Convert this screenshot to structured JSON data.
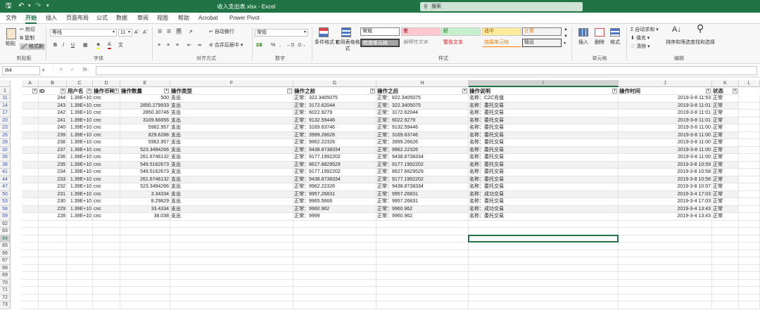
{
  "window": {
    "title": "收入支出表.xlsx  -  Excel",
    "search_placeholder": "搜索",
    "quick_access": [
      "save-icon",
      "undo-icon",
      "redo-icon",
      "customize-icon"
    ]
  },
  "tabs": [
    "文件",
    "开始",
    "插入",
    "页面布局",
    "公式",
    "数据",
    "审阅",
    "视图",
    "帮助",
    "Acrobat",
    "Power Pivot"
  ],
  "active_tab": "开始",
  "ribbon": {
    "clipboard": {
      "paste": "粘贴",
      "cut": "剪切",
      "copy": "复制",
      "format_painter": "格式刷",
      "label": "剪贴板"
    },
    "font": {
      "name": "等线",
      "size": "11",
      "label": "字体"
    },
    "alignment": {
      "wrap": "自动换行",
      "merge": "合并后居中",
      "label": "对齐方式"
    },
    "number": {
      "format": "常规",
      "label": "数字"
    },
    "styles": {
      "conditional": "条件格式",
      "table_format": "套用表格格式",
      "items": [
        "常规",
        "差",
        "好",
        "适中",
        "计算",
        "检查单元格",
        "解释性文本",
        "警告文本",
        "链接单元格",
        "输出"
      ],
      "label": "样式"
    },
    "cells": {
      "insert": "插入",
      "delete": "删除",
      "format": "格式",
      "label": "单元格"
    },
    "editing": {
      "autosum": "自动求和",
      "fill": "填充",
      "clear": "清除",
      "sort": "排序和筛选",
      "find": "查找和选择",
      "label": "编辑"
    }
  },
  "formula_bar": {
    "name_box": "I64",
    "fx": "fx",
    "content": ""
  },
  "columns": [
    "A",
    "B",
    "C",
    "D",
    "E",
    "F",
    "G",
    "H",
    "I",
    "J",
    "K",
    "L"
  ],
  "active_column": "I",
  "headers": [
    "",
    "ID",
    "用户名",
    "操作币种",
    "操作数量",
    "操作类型",
    "操作之前",
    "操作之后",
    "操作说明",
    "操作时间",
    "状态"
  ],
  "rows": [
    {
      "row": "11",
      "id": "244",
      "user": "1.39E+10",
      "coin": "cnc",
      "qty": "500",
      "type": "支出",
      "before": "正常：322.3405075",
      "after": "正常：822.3405075",
      "desc": "名称：C2C充值",
      "time": "2019-3-8 11:53",
      "status": "正常"
    },
    {
      "row": "14",
      "id": "243",
      "user": "1.39E+10",
      "coin": "cnc",
      "qty": "2850.279933",
      "type": "支出",
      "before": "正常：3172.62044",
      "after": "正常：322.3405075",
      "desc": "名称：委托交易",
      "time": "2019-3-8 11:01",
      "status": "正常"
    },
    {
      "row": "17",
      "id": "242",
      "user": "1.39E+10",
      "coin": "cnc",
      "qty": "2850.30746",
      "type": "支出",
      "before": "正常：6022.9279",
      "after": "正常：3172.62044",
      "desc": "名称：委托交易",
      "time": "2019-3-8 11:01",
      "status": "正常"
    },
    {
      "row": "20",
      "id": "241",
      "user": "1.39E+10",
      "coin": "cnc",
      "qty": "3109.66656",
      "type": "支出",
      "before": "正常：9132.59446",
      "after": "正常：6022.9279",
      "desc": "名称：委托交易",
      "time": "2019-3-8 11:01",
      "status": "正常"
    },
    {
      "row": "23",
      "id": "240",
      "user": "1.39E+10",
      "coin": "cnc",
      "qty": "5962.957",
      "type": "支出",
      "before": "正常：3169.63746",
      "after": "正常：9132.59446",
      "desc": "名称：委托交易",
      "time": "2019-3-8 11:00",
      "status": "正常"
    },
    {
      "row": "26",
      "id": "239",
      "user": "1.39E+10",
      "coin": "cnc",
      "qty": "829.6288",
      "type": "支出",
      "before": "正常：3999.26626",
      "after": "正常：3169.63746",
      "desc": "名称：委托交易",
      "time": "2019-3-8 11:00",
      "status": "正常"
    },
    {
      "row": "29",
      "id": "238",
      "user": "1.39E+10",
      "coin": "cnc",
      "qty": "5962.957",
      "type": "支出",
      "before": "正常：9962.22326",
      "after": "正常：3999.26626",
      "desc": "名称：委托交易",
      "time": "2019-3-8 11:00",
      "status": "正常"
    },
    {
      "row": "32",
      "id": "237",
      "user": "1.39E+10",
      "coin": "cnc",
      "qty": "523.3494266",
      "type": "支出",
      "before": "正常：9438.8738334",
      "after": "正常：9962.22326",
      "desc": "名称：委托交易",
      "time": "2019-3-8 11:00",
      "status": "正常"
    },
    {
      "row": "35",
      "id": "236",
      "user": "1.39E+10",
      "coin": "cnc",
      "qty": "261.6746132",
      "type": "支出",
      "before": "正常：9177.1992202",
      "after": "正常：9438.8738334",
      "desc": "名称：委托交易",
      "time": "2019-3-8 11:00",
      "status": "正常"
    },
    {
      "row": "38",
      "id": "235",
      "user": "1.39E+10",
      "coin": "cnc",
      "qty": "549.5162673",
      "type": "支出",
      "before": "正常：8627.6829529",
      "after": "正常：9177.1992202",
      "desc": "名称：委托交易",
      "time": "2019-3-8 10:59",
      "status": "正常"
    },
    {
      "row": "41",
      "id": "234",
      "user": "1.39E+10",
      "coin": "cnc",
      "qty": "549.5162673",
      "type": "支出",
      "before": "正常：9177.1992202",
      "after": "正常：8627.6829529",
      "desc": "名称：委托交易",
      "time": "2019-3-8 10:58",
      "status": "正常"
    },
    {
      "row": "44",
      "id": "233",
      "user": "1.39E+10",
      "coin": "cnc",
      "qty": "261.6746132",
      "type": "支出",
      "before": "正常：9438.8738334",
      "after": "正常：9177.1992202",
      "desc": "名称：委托交易",
      "time": "2019-3-8 10:58",
      "status": "正常"
    },
    {
      "row": "47",
      "id": "232",
      "user": "1.39E+10",
      "coin": "cnc",
      "qty": "523.3494266",
      "type": "支出",
      "before": "正常：9962.22326",
      "after": "正常：9438.8738334",
      "desc": "名称：委托交易",
      "time": "2019-3-8 10:57",
      "status": "正常"
    },
    {
      "row": "50",
      "id": "231",
      "user": "1.39E+10",
      "coin": "cnc",
      "qty": "3.34334",
      "type": "支出",
      "before": "正常：9957.26831",
      "after": "正常：9957.26831",
      "desc": "名称：成功交易",
      "time": "2019-3-4 17:03",
      "status": "正常"
    },
    {
      "row": "53",
      "id": "230",
      "user": "1.39E+10",
      "coin": "cnc",
      "qty": "8.29829",
      "type": "支出",
      "before": "正常：9965.5666",
      "after": "正常：9957.26831",
      "desc": "名称：委托交易",
      "time": "2019-3-4 17:03",
      "status": "正常"
    },
    {
      "row": "56",
      "id": "229",
      "user": "1.39E+10",
      "coin": "cnc",
      "qty": "33.4334",
      "type": "支出",
      "before": "正常：9960.962",
      "after": "正常：9960.962",
      "desc": "名称：成功交易",
      "time": "2019-3-4 13:43",
      "status": "正常"
    },
    {
      "row": "59",
      "id": "228",
      "user": "1.39E+10",
      "coin": "cnc",
      "qty": "38.038",
      "type": "支出",
      "before": "正常：9999",
      "after": "正常：9960.962",
      "desc": "名称：委托交易",
      "time": "2019-3-4 13:43",
      "status": "正常"
    }
  ],
  "empty_rows": [
    "62",
    "63",
    "64",
    "65",
    "66",
    "67",
    "68",
    "69",
    "70",
    "71",
    "72",
    "73"
  ],
  "active_row": "64"
}
